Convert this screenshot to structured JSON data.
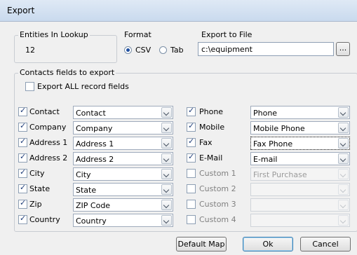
{
  "window": {
    "title": "Export"
  },
  "entities": {
    "label": "Entities In Lookup",
    "count": "12"
  },
  "format": {
    "label": "Format",
    "options": [
      "CSV",
      "Tab"
    ],
    "selected": "CSV"
  },
  "file": {
    "label": "Export to File",
    "path": "c:\\equipment",
    "browse": "..."
  },
  "fields": {
    "label": "Contacts fields to export",
    "export_all": "Export ALL record fields",
    "left": [
      {
        "label": "Contact",
        "value": "Contact",
        "checked": true
      },
      {
        "label": "Company",
        "value": "Company",
        "checked": true
      },
      {
        "label": "Address 1",
        "value": "Address 1",
        "checked": true
      },
      {
        "label": "Address 2",
        "value": "Address 2",
        "checked": true
      },
      {
        "label": "City",
        "value": "City",
        "checked": true
      },
      {
        "label": "State",
        "value": "State",
        "checked": true
      },
      {
        "label": "Zip",
        "value": "ZIP Code",
        "checked": true
      },
      {
        "label": "Country",
        "value": "Country",
        "checked": true
      }
    ],
    "right": [
      {
        "label": "Phone",
        "value": "Phone",
        "checked": true,
        "enabled": true
      },
      {
        "label": "Mobile",
        "value": "Mobile Phone",
        "checked": true,
        "enabled": true
      },
      {
        "label": "Fax",
        "value": "Fax Phone",
        "checked": true,
        "enabled": true
      },
      {
        "label": "E-Mail",
        "value": "E-mail",
        "checked": true,
        "enabled": true
      },
      {
        "label": "Custom 1",
        "value": "First Purchase",
        "checked": false,
        "enabled": false
      },
      {
        "label": "Custom 2",
        "value": "",
        "checked": false,
        "enabled": false
      },
      {
        "label": "Custom 3",
        "value": "",
        "checked": false,
        "enabled": false
      },
      {
        "label": "Custom 4",
        "value": "",
        "checked": false,
        "enabled": false
      }
    ]
  },
  "buttons": {
    "default_map": "Default Map",
    "ok": "Ok",
    "cancel": "Cancel"
  }
}
